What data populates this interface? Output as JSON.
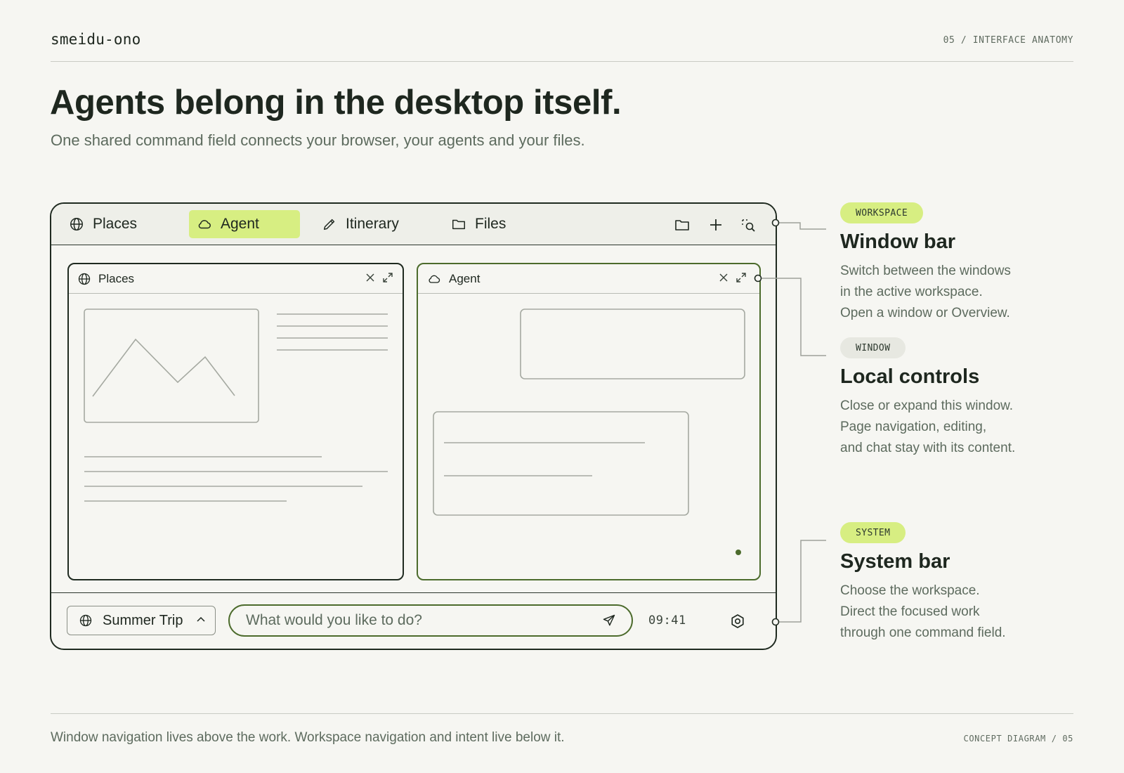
{
  "header": {
    "brand": "smeidu-ono",
    "slide_label": "05 / INTERFACE ANATOMY",
    "title": "Agents belong in the desktop itself.",
    "subtitle": "One shared command field connects your browser, your agents and your files."
  },
  "window_bar": {
    "tabs": [
      {
        "label": "Places",
        "icon": "globe-icon",
        "active": false
      },
      {
        "label": "Agent",
        "icon": "cloud-icon",
        "active": true
      },
      {
        "label": "Itinerary",
        "icon": "pencil-icon",
        "active": false
      },
      {
        "label": "Files",
        "icon": "folder-icon",
        "active": false
      }
    ],
    "actions": [
      "folder-icon",
      "plus-icon",
      "overview-search-icon"
    ]
  },
  "windows": [
    {
      "title": "Places",
      "icon": "globe-icon",
      "focused": false,
      "controls": [
        "close-icon",
        "expand-icon"
      ]
    },
    {
      "title": "Agent",
      "icon": "cloud-icon",
      "focused": true,
      "controls": [
        "close-icon",
        "expand-icon"
      ]
    }
  ],
  "system_bar": {
    "workspace": "Summer Trip",
    "command_placeholder": "What would you like to do?",
    "clock": "09:41"
  },
  "callouts": [
    {
      "badge": "WORKSPACE",
      "title": "Window bar",
      "lines": [
        "Switch between the windows",
        "in the active workspace.",
        "Open a window or Overview."
      ]
    },
    {
      "badge": "WINDOW",
      "title": "Local controls",
      "lines": [
        "Close or expand this window.",
        "Page navigation, editing,",
        "and chat stay with its content."
      ]
    },
    {
      "badge": "SYSTEM",
      "title": "System bar",
      "lines": [
        "Choose the workspace.",
        "Direct the focused work",
        "through one command field."
      ]
    }
  ],
  "footer": {
    "note": "Window navigation lives above the work. Workspace navigation and intent live below it.",
    "label": "CONCEPT DIAGRAM / 05"
  },
  "colors": {
    "accent_lime": "#d7ee82",
    "focus_green": "#4c6b2c",
    "ink": "#1e271f",
    "muted": "#5d6b5e",
    "background": "#f6f6f2"
  }
}
